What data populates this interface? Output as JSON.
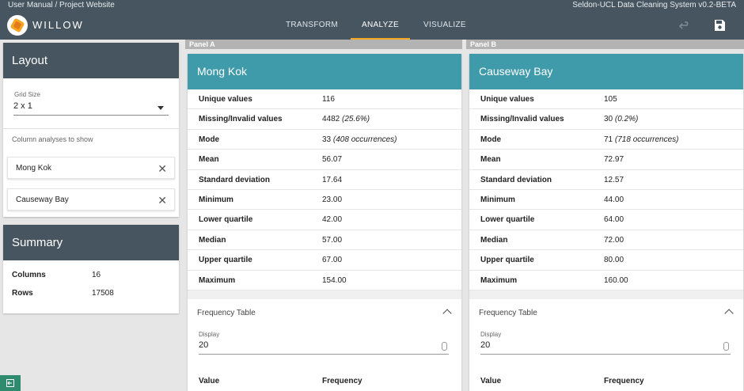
{
  "topbar": {
    "left_text": "User Manual / Project Website",
    "right_text": "Seldon-UCL Data Cleaning System v0.2-BETA"
  },
  "nav": {
    "brand": "WILLOW",
    "tabs": [
      {
        "label": "TRANSFORM",
        "active": false
      },
      {
        "label": "ANALYZE",
        "active": true
      },
      {
        "label": "VISUALIZE",
        "active": false
      }
    ],
    "icons": [
      "undo-icon",
      "save-icon"
    ],
    "accent": "#f6a623",
    "bar_color": "#46555f"
  },
  "layout": {
    "title": "Layout",
    "grid_size_label": "Grid Size",
    "grid_size_value": "2 x 1",
    "analyses_label": "Column analyses to show",
    "chips": [
      "Mong Kok",
      "Causeway Bay"
    ]
  },
  "summary": {
    "title": "Summary",
    "rows": [
      {
        "key": "Columns",
        "value": "16"
      },
      {
        "key": "Rows",
        "value": "17508"
      }
    ]
  },
  "panels": [
    {
      "label": "Panel A",
      "title": "Mong Kok",
      "stats": [
        {
          "key": "Unique values",
          "value": "116",
          "note": ""
        },
        {
          "key": "Missing/Invalid values",
          "value": "4482",
          "note": "(25.6%)"
        },
        {
          "key": "Mode",
          "value": "33",
          "note": "(408 occurrences)"
        },
        {
          "key": "Mean",
          "value": "56.07",
          "note": ""
        },
        {
          "key": "Standard deviation",
          "value": "17.64",
          "note": ""
        },
        {
          "key": "Minimum",
          "value": "23.00",
          "note": ""
        },
        {
          "key": "Lower quartile",
          "value": "42.00",
          "note": ""
        },
        {
          "key": "Median",
          "value": "57.00",
          "note": ""
        },
        {
          "key": "Upper quartile",
          "value": "67.00",
          "note": ""
        },
        {
          "key": "Maximum",
          "value": "154.00",
          "note": ""
        }
      ],
      "freq_title": "Frequency Table",
      "display_label": "Display",
      "display_value": "20",
      "col_value": "Value",
      "col_frequency": "Frequency"
    },
    {
      "label": "Panel B",
      "title": "Causeway Bay",
      "stats": [
        {
          "key": "Unique values",
          "value": "105",
          "note": ""
        },
        {
          "key": "Missing/Invalid values",
          "value": "30",
          "note": "(0.2%)"
        },
        {
          "key": "Mode",
          "value": "71",
          "note": "(718 occurrences)"
        },
        {
          "key": "Mean",
          "value": "72.97",
          "note": ""
        },
        {
          "key": "Standard deviation",
          "value": "12.57",
          "note": ""
        },
        {
          "key": "Minimum",
          "value": "44.00",
          "note": ""
        },
        {
          "key": "Lower quartile",
          "value": "64.00",
          "note": ""
        },
        {
          "key": "Median",
          "value": "72.00",
          "note": ""
        },
        {
          "key": "Upper quartile",
          "value": "80.00",
          "note": ""
        },
        {
          "key": "Maximum",
          "value": "160.00",
          "note": ""
        }
      ],
      "freq_title": "Frequency Table",
      "display_label": "Display",
      "display_value": "20",
      "col_value": "Value",
      "col_frequency": "Frequency"
    }
  ],
  "colors": {
    "panel_header": "#3f9aa9",
    "sidebar_header": "#46555f",
    "bottom_button": "#2e8b6e"
  },
  "bottom_icon": "exit-icon"
}
